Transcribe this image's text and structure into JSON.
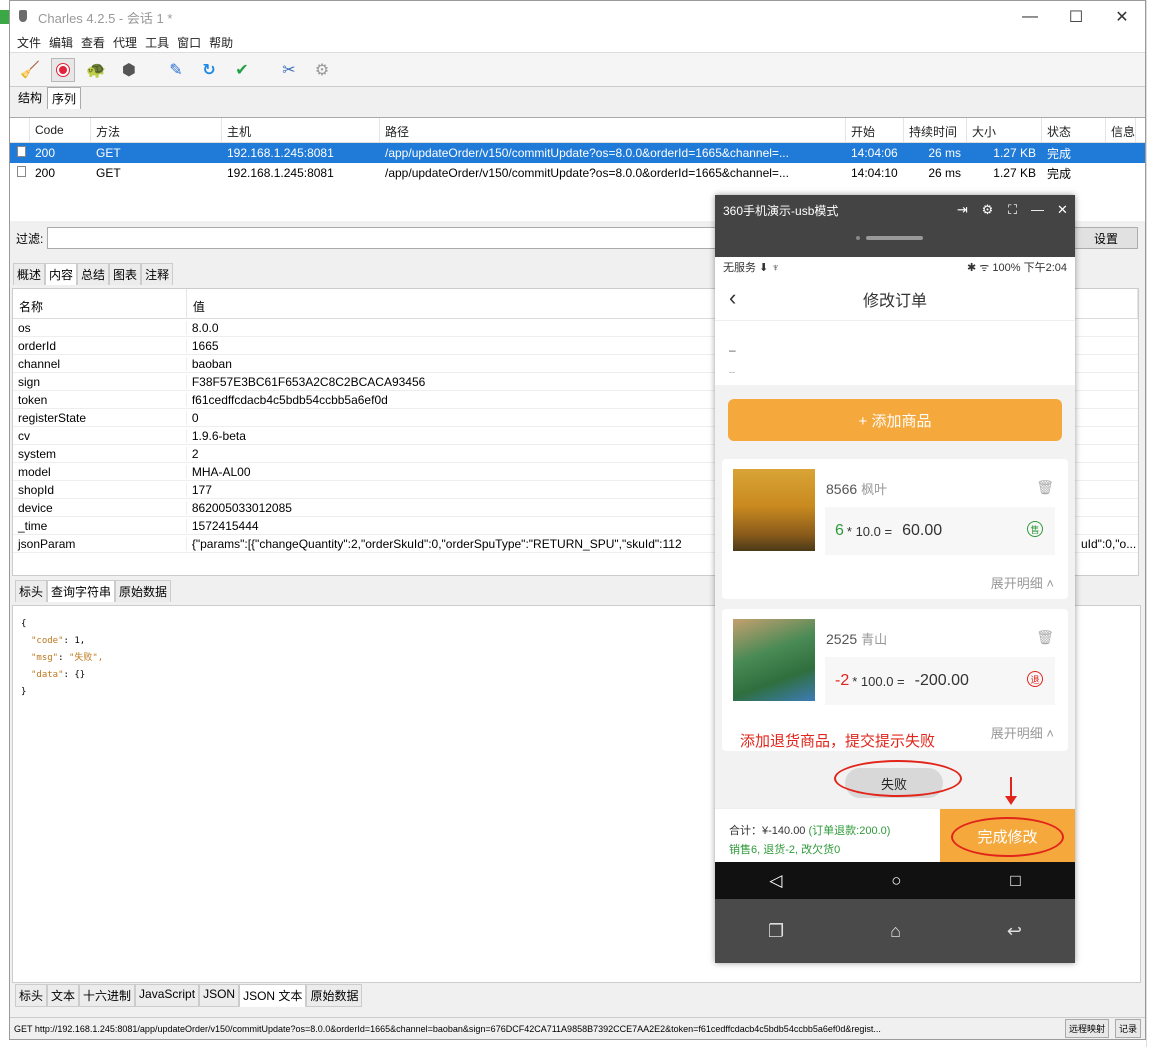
{
  "window": {
    "title": "Charles 4.2.5 - 会话 1 *",
    "controls": [
      "—",
      "☐",
      "✕"
    ]
  },
  "menu": [
    "文件",
    "编辑",
    "查看",
    "代理",
    "工具",
    "窗口",
    "帮助"
  ],
  "view_tabs": [
    "结构",
    "序列"
  ],
  "request_table": {
    "headers": [
      "Code",
      "方法",
      "主机",
      "路径",
      "开始",
      "持续时间",
      "大小",
      "状态",
      "信息"
    ],
    "rows": [
      {
        "code": "200",
        "method": "GET",
        "host": "192.168.1.245:8081",
        "path": "/app/updateOrder/v150/commitUpdate?os=8.0.0&orderId=1665&channel=...",
        "start": "14:04:06",
        "duration": "26 ms",
        "size": "1.27 KB",
        "status": "完成",
        "info": ""
      },
      {
        "code": "200",
        "method": "GET",
        "host": "192.168.1.245:8081",
        "path": "/app/updateOrder/v150/commitUpdate?os=8.0.0&orderId=1665&channel=...",
        "start": "14:04:10",
        "duration": "26 ms",
        "size": "1.27 KB",
        "status": "完成",
        "info": ""
      }
    ]
  },
  "filter": {
    "label": "过滤:",
    "value": "",
    "settings_button": "设置"
  },
  "detail_tabs": [
    "概述",
    "内容",
    "总结",
    "图表",
    "注释"
  ],
  "kv_table": {
    "headers": [
      "名称",
      "值"
    ],
    "rows": [
      {
        "k": "os",
        "v": "8.0.0"
      },
      {
        "k": "orderId",
        "v": "1665"
      },
      {
        "k": "channel",
        "v": "baoban"
      },
      {
        "k": "sign",
        "v": "F38F57E3BC61F653A2C8C2BCACA93456"
      },
      {
        "k": "token",
        "v": "f61cedffcdacb4c5bdb54ccbb5a6ef0d"
      },
      {
        "k": "registerState",
        "v": "0"
      },
      {
        "k": "cv",
        "v": "1.9.6-beta"
      },
      {
        "k": "system",
        "v": "2"
      },
      {
        "k": "model",
        "v": "MHA-AL00"
      },
      {
        "k": "shopId",
        "v": "177"
      },
      {
        "k": "device",
        "v": "862005033012085"
      },
      {
        "k": "_time",
        "v": "1572415444"
      },
      {
        "k": "jsonParam",
        "v": "{\"params\":[{\"changeQuantity\":2,\"orderSkuId\":0,\"orderSpuType\":\"RETURN_SPU\",\"skuId\":112"
      }
    ],
    "row_tail": "uId\":0,\"o..."
  },
  "sub_tabs": [
    "标头",
    "查询字符串",
    "原始数据"
  ],
  "response_json": {
    "open": "{",
    "lines": [
      {
        "key": "\"code\"",
        "value": "1,"
      },
      {
        "key": "\"msg\"",
        "value": "\"失败\","
      },
      {
        "key": "\"data\"",
        "value": "{}"
      }
    ],
    "close": "}"
  },
  "bottom_tabs": [
    "标头",
    "文本",
    "十六进制",
    "JavaScript",
    "JSON",
    "JSON 文本",
    "原始数据"
  ],
  "status_bar": {
    "url": "GET http://192.168.1.245:8081/app/updateOrder/v150/commitUpdate?os=8.0.0&orderId=1665&channel=baoban&sign=676DCF42CA711A9858B7392CCE7AA2E2&token=f61cedffcdacb4c5bdb54ccbb5a6ef0d&regist...",
    "btn1": "远程映射",
    "btn2": "记录"
  },
  "phone": {
    "window_title": "360手机演示-usb模式",
    "status_left": "无服务 ⬇ ♆",
    "status_right": "✱ ᯤ 100% 下午2:04",
    "nav_title": "修改订单",
    "back": "‹",
    "remark_line1": "–",
    "remark_line2": "--",
    "add_button": "+ 添加商品",
    "item1": {
      "id": "8566",
      "name": "枫叶",
      "qty": "6",
      "price": "* 10.0 =",
      "total": "60.00",
      "badge": "售",
      "expand": "展开明细 ˄"
    },
    "item2": {
      "id": "2525",
      "name": "青山",
      "qty": "-2",
      "price": "* 100.0 =",
      "total": "-200.00",
      "badge": "退",
      "expand": "展开明细 ˄"
    },
    "annotation": "添加退货商品，提交提示失败",
    "toast": "失败",
    "footer_line1_prefix": "合计：¥-140.00",
    "footer_line1_suffix": "(订单退款:200.0)",
    "footer_line2": "销售6, 退货-2, 改欠货0",
    "finish_button": "完成修改",
    "colors": {
      "accent": "#f5a83c",
      "annotation": "#e1251b",
      "positive": "#2f9a3a"
    }
  }
}
